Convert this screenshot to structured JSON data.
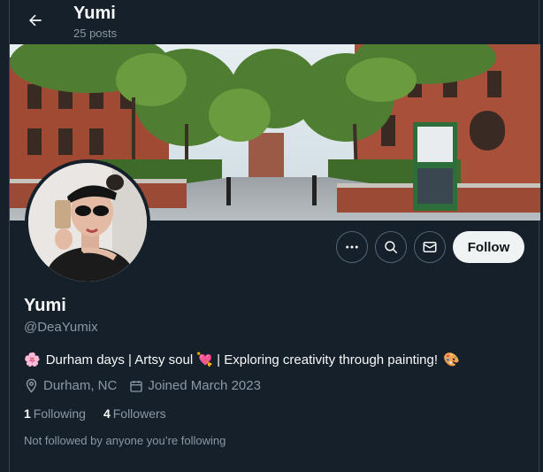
{
  "header": {
    "title": "Yumi",
    "post_count": "25 posts",
    "back_icon": "arrow-left-icon"
  },
  "profile": {
    "name": "Yumi",
    "handle": "@DeaYumix",
    "bio": "Durham days | Artsy soul 💘 | Exploring creativity through painting!",
    "bio_leading_emoji": "🌸",
    "bio_trailing_emoji": "🎨",
    "location": "Durham, NC",
    "joined": "Joined March 2023",
    "following_count": "1",
    "following_label": "Following",
    "followers_count": "4",
    "followers_label": "Followers",
    "mutuals_note": "Not followed by anyone you’re following"
  },
  "actions": {
    "more_icon": "more-dots-icon",
    "search_icon": "search-icon",
    "message_icon": "envelope-icon",
    "follow_label": "Follow"
  },
  "colors": {
    "background": "#15202b",
    "muted_text": "#8b98a5",
    "border": "#536471",
    "follow_bg": "#eff3f4"
  }
}
